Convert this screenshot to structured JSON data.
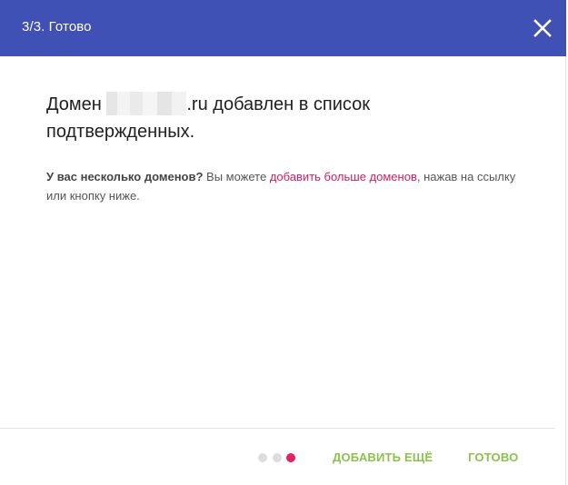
{
  "header": {
    "title": "3/3. Готово",
    "close_icon": "close-icon"
  },
  "message": {
    "prefix": "Домен ",
    "suffix": ".ru добавлен в список подтвержденных."
  },
  "info": {
    "bold": "У вас несколько доменов?",
    "text_before_link": " Вы можете ",
    "link": "добавить больше доменов",
    "text_after_link": ", нажав на ссылку или кнопку ниже."
  },
  "stepper": {
    "total": 3,
    "current": 3
  },
  "footer": {
    "add_more_label": "ДОБАВИТЬ ЕЩЁ",
    "done_label": "ГОТОВО"
  },
  "colors": {
    "header_bg": "#3f51b5",
    "link": "#d81b60",
    "active_dot": "#e91e63",
    "button_text": "#8bc34a"
  }
}
